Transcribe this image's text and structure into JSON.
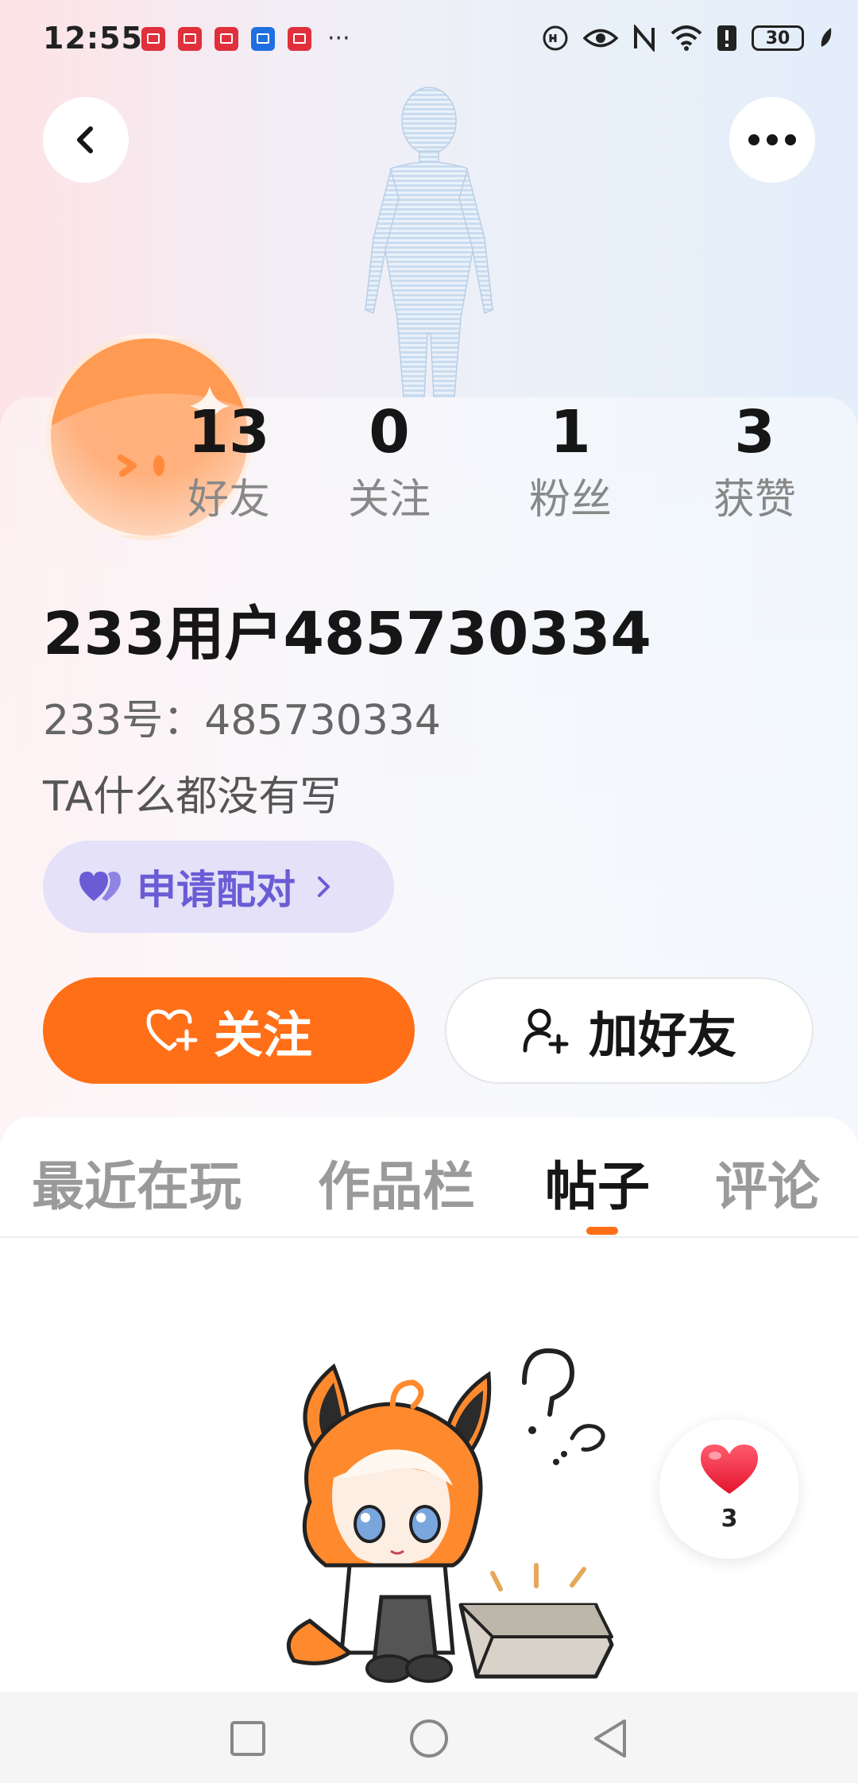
{
  "status_bar": {
    "time": "12:55",
    "notification_icons": [
      "book-icon",
      "book-icon",
      "book-icon",
      "bulb-icon",
      "book-icon"
    ],
    "more": "···",
    "battery": "30"
  },
  "header": {
    "back_icon": "chevron-left-icon",
    "more_icon": "ellipsis-icon"
  },
  "profile": {
    "stats": [
      {
        "value": "13",
        "label": "好友"
      },
      {
        "value": "0",
        "label": "关注"
      },
      {
        "value": "1",
        "label": "粉丝"
      },
      {
        "value": "3",
        "label": "获赞"
      }
    ],
    "username": "233用户485730334",
    "user_id": "233号：485730334",
    "bio": "TA什么都没有写"
  },
  "actions": {
    "pair_label": "申请配对",
    "follow_label": "关注",
    "add_friend_label": "加好友"
  },
  "tabs": [
    {
      "label": "最近在玩"
    },
    {
      "label": "作品栏"
    },
    {
      "label": "帖子",
      "active": true
    },
    {
      "label": "评论"
    }
  ],
  "like_button": {
    "count": "3"
  },
  "colors": {
    "accent": "#ff6f17",
    "pair": "#6b5cd6",
    "pair_bg": "#e4e1f8"
  }
}
